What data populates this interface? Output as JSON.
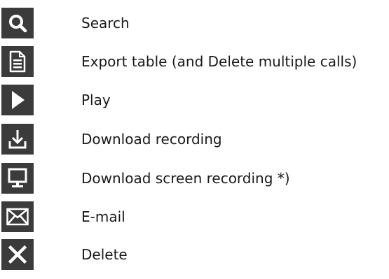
{
  "legend": {
    "items": [
      {
        "icon": "search-icon",
        "label": "Search"
      },
      {
        "icon": "document-icon",
        "label": "Export table (and Delete multiple calls)"
      },
      {
        "icon": "play-icon",
        "label": "Play"
      },
      {
        "icon": "download-icon",
        "label": "Download recording"
      },
      {
        "icon": "monitor-icon",
        "label": "Download screen recording *)"
      },
      {
        "icon": "envelope-icon",
        "label": "E-mail"
      },
      {
        "icon": "close-icon",
        "label": "Delete"
      }
    ]
  },
  "colors": {
    "icon_background": "#3b3b3b",
    "icon_foreground": "#ffffff",
    "text": "#1a1a1a"
  }
}
